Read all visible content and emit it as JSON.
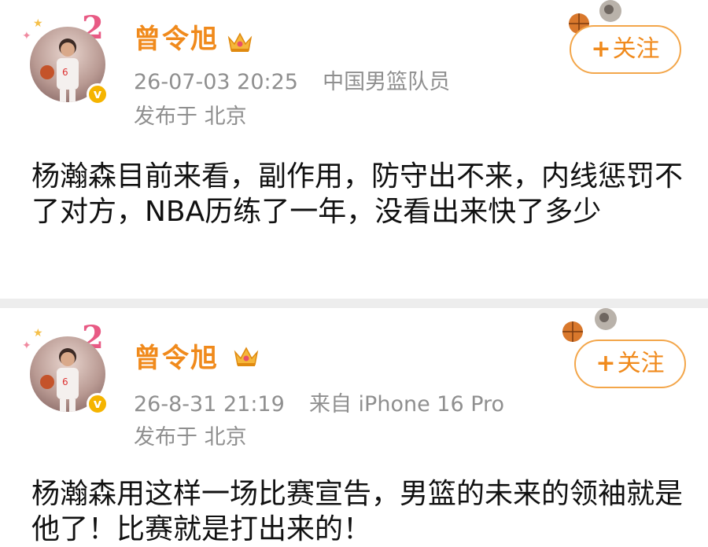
{
  "posts": [
    {
      "author": "曾令旭",
      "time": "26-07-03 20:25",
      "source": "中国男篮队员",
      "location": "发布于 北京",
      "follow_label": "关注",
      "content": "杨瀚森目前来看，副作用，防守出不来，内线惩罚不了对方，NBA历练了一年，没看出来快了多少"
    },
    {
      "author": "曾令旭",
      "time": "26-8-31 21:19",
      "source": "来自 iPhone 16 Pro",
      "location": "发布于 北京",
      "follow_label": "关注",
      "content": "杨瀚森用这样一场比赛宣告，男篮的未来的领袖就是他了！比赛就是打出来的！"
    }
  ],
  "icons": {
    "follow": "plus-icon",
    "verified": "verified-badge-icon",
    "vip": "crown-icon",
    "decoration": "basketball-badge-icon"
  },
  "colors": {
    "accent": "#f08a1c",
    "meta": "#8f8f8f",
    "verified": "#f5b400",
    "text": "#111111"
  }
}
